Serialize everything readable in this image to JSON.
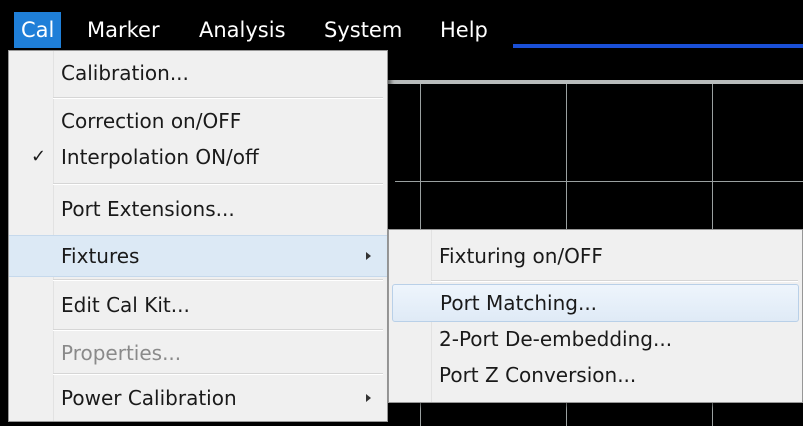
{
  "menubar": {
    "items": [
      {
        "label": "Cal"
      },
      {
        "label": "Marker"
      },
      {
        "label": "Analysis"
      },
      {
        "label": "System"
      },
      {
        "label": "Help"
      }
    ]
  },
  "cal_menu": {
    "items": [
      {
        "label": "Calibration..."
      },
      {
        "label": "Correction on/OFF"
      },
      {
        "label": "Interpolation ON/off",
        "checked": true,
        "check_glyph": "✓"
      },
      {
        "label": "Port Extensions..."
      },
      {
        "label": "Fixtures",
        "has_submenu": true
      },
      {
        "label": "Edit Cal Kit..."
      },
      {
        "label": "Properties...",
        "disabled": true
      },
      {
        "label": "Power Calibration",
        "has_submenu": true
      }
    ]
  },
  "fixtures_submenu": {
    "items": [
      {
        "label": "Fixturing on/OFF"
      },
      {
        "label": "Port Matching..."
      },
      {
        "label": "2-Port De-embedding..."
      },
      {
        "label": "Port Z Conversion..."
      }
    ]
  },
  "colors": {
    "menubar_bg": "#000000",
    "active_menu": "#1f7fd8",
    "menu_bg": "#f0f0f0",
    "highlight": "#dce9f5",
    "accent_line": "#1a4fd6"
  }
}
